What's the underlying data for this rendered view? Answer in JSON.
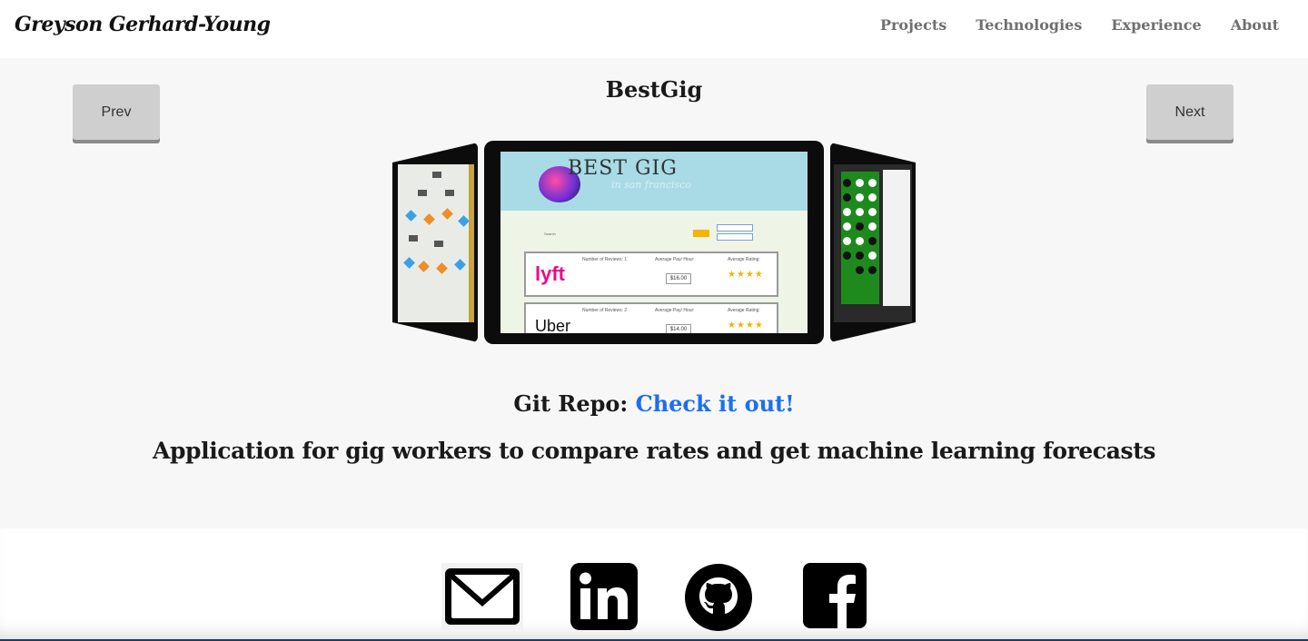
{
  "nav": {
    "brand": "Greyson Gerhard-Young",
    "links": [
      {
        "label": "Projects"
      },
      {
        "label": "Technologies"
      },
      {
        "label": "Experience"
      },
      {
        "label": "About"
      }
    ]
  },
  "project": {
    "prev_label": "Prev",
    "next_label": "Next",
    "title": "BestGig",
    "git_label": "Git Repo:",
    "git_link_text": "Check it out!",
    "description": "Application for gig workers to compare rates and get machine learning forecasts"
  },
  "screenshot": {
    "logo_text": "BEST GIG",
    "logo_sub": "in san francisco",
    "search_label": "Search",
    "cards": [
      {
        "company": "lyft",
        "reviews": "Number of Reviews: 1",
        "pay_label": "Average Pay/ Hour:",
        "pay": "$16.00",
        "rating_label": "Average Rating:",
        "stars": "★★★★"
      },
      {
        "company": "Uber",
        "reviews": "Number of Reviews: 2",
        "pay_label": "Average Pay/ Hour:",
        "pay": "$14.00",
        "rating_label": "Average Rating:",
        "stars": "★★★★"
      }
    ]
  },
  "footer": {
    "icons": [
      "email-icon",
      "linkedin-icon",
      "github-icon",
      "facebook-icon"
    ]
  },
  "colors": {
    "accent_link": "#1a6ff2",
    "section_bg": "#f7f7f7",
    "button_bg": "#cfcfcf"
  }
}
